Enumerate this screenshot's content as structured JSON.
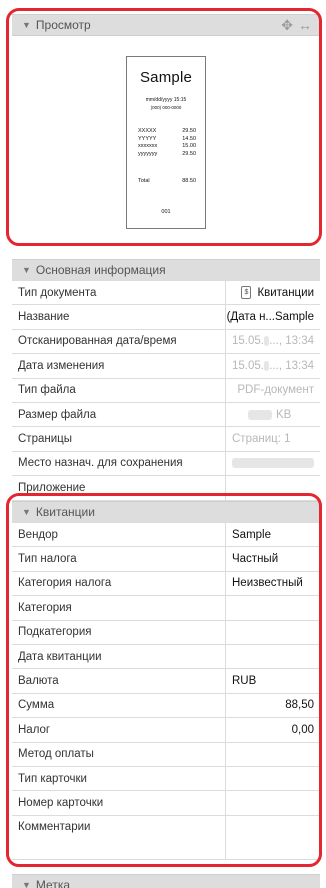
{
  "preview": {
    "header": "Просмотр",
    "tool_move": "✥",
    "tool_resize": "↔",
    "receipt": {
      "title": "Sample",
      "date": "mm/dd/yyyy 15:15",
      "phone": "(000) 000-0000",
      "items": [
        {
          "name": "XXXXX",
          "price": "29.50"
        },
        {
          "name": "YYYYY",
          "price": "14.50"
        },
        {
          "name": "xxxxxxx",
          "price": "15.00"
        },
        {
          "name": "yyyyyyy",
          "price": "29.50"
        }
      ],
      "total_label": "Total",
      "total_value": "88.50",
      "number": "001"
    }
  },
  "basic_info": {
    "header": "Основная информация",
    "rows": [
      {
        "label": "Тип документа",
        "value": "Квитанции",
        "icon": "$"
      },
      {
        "label": "Название",
        "value": "(Дата н...Sample"
      },
      {
        "label": "Отсканированная дата/время",
        "value_start": "15.05.",
        "value_end": "..., 13:34"
      },
      {
        "label": "Дата изменения",
        "value_start": "15.05.",
        "value_end": "..., 13:34"
      },
      {
        "label": "Тип файла",
        "value": "PDF-документ"
      },
      {
        "label": "Размер файла",
        "value": "KB"
      },
      {
        "label": "Страницы",
        "value": "Страниц: 1"
      },
      {
        "label": "Место назнач. для сохранения",
        "value": ""
      },
      {
        "label": "Приложение",
        "value": ""
      }
    ]
  },
  "receipts": {
    "header": "Квитанции",
    "rows": [
      {
        "label": "Вендор",
        "value": "Sample"
      },
      {
        "label": "Тип налога",
        "value": "Частный"
      },
      {
        "label": "Категория налога",
        "value": "Неизвестный"
      },
      {
        "label": "Категория",
        "value": ""
      },
      {
        "label": "Подкатегория",
        "value": ""
      },
      {
        "label": "Дата квитанции",
        "value": ""
      },
      {
        "label": "Валюта",
        "value": "RUB"
      },
      {
        "label": "Сумма",
        "value": "88,50"
      },
      {
        "label": "Налог",
        "value": "0,00"
      },
      {
        "label": "Метод оплаты",
        "value": ""
      },
      {
        "label": "Тип карточки",
        "value": ""
      },
      {
        "label": "Номер карточки",
        "value": ""
      },
      {
        "label": "Комментарии",
        "value": ""
      }
    ]
  },
  "tag": {
    "header": "Метка"
  },
  "colors": {
    "highlight": "#e3262f",
    "header_bg": "#dddddd"
  }
}
